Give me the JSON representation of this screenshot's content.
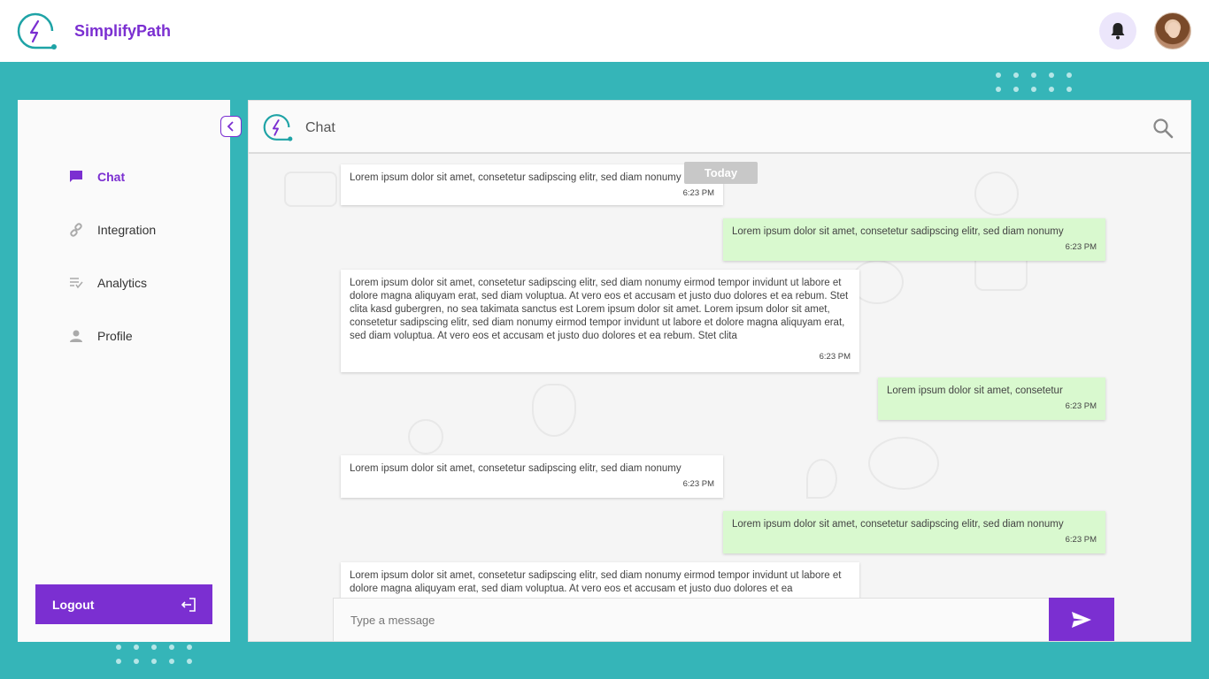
{
  "app": {
    "brand_name": "SimplifyPath",
    "accent_color": "#7b2fd1",
    "background_color": "#35b5b8"
  },
  "header": {
    "icons": [
      "bell-icon",
      "avatar"
    ]
  },
  "sidebar": {
    "items": [
      {
        "label": "Chat",
        "icon": "chat-icon",
        "active": true
      },
      {
        "label": "Integration",
        "icon": "link-icon",
        "active": false
      },
      {
        "label": "Analytics",
        "icon": "list-check-icon",
        "active": false
      },
      {
        "label": "Profile",
        "icon": "person-icon",
        "active": false
      }
    ],
    "logout_label": "Logout"
  },
  "chat": {
    "title": "Chat",
    "date_separator": "Today",
    "messages": [
      {
        "direction": "in",
        "text": "Lorem ipsum dolor sit amet, consetetur sadipscing elitr, sed diam nonumy",
        "time": "6:23 PM"
      },
      {
        "direction": "out",
        "text": "Lorem ipsum dolor sit amet, consetetur sadipscing elitr, sed diam nonumy",
        "time": "6:23 PM"
      },
      {
        "direction": "in",
        "text": "Lorem ipsum dolor sit amet, consetetur sadipscing elitr, sed diam nonumy eirmod tempor invidunt ut labore et dolore magna aliquyam erat, sed diam voluptua. At vero eos et accusam et justo duo dolores et ea rebum. Stet clita kasd gubergren, no sea takimata sanctus est Lorem ipsum dolor sit amet. Lorem ipsum dolor sit amet, consetetur sadipscing elitr, sed diam nonumy eirmod tempor invidunt ut labore et dolore magna aliquyam erat, sed diam voluptua. At vero eos et accusam et justo duo dolores et ea rebum. Stet clita",
        "time": "6:23 PM"
      },
      {
        "direction": "out",
        "text": "Lorem ipsum dolor sit amet, consetetur",
        "time": "6:23 PM"
      },
      {
        "direction": "in",
        "text": "Lorem ipsum dolor sit amet, consetetur sadipscing elitr, sed diam nonumy",
        "time": "6:23 PM"
      },
      {
        "direction": "out",
        "text": "Lorem ipsum dolor sit amet, consetetur sadipscing elitr, sed diam nonumy",
        "time": "6:23 PM"
      },
      {
        "direction": "in",
        "text": "Lorem ipsum dolor sit amet, consetetur sadipscing elitr, sed diam nonumy eirmod tempor invidunt ut labore et dolore magna aliquyam erat, sed diam voluptua. At vero eos et accusam et justo duo dolores et ea",
        "time": ""
      }
    ],
    "composer": {
      "placeholder": "Type a message",
      "value": ""
    }
  }
}
